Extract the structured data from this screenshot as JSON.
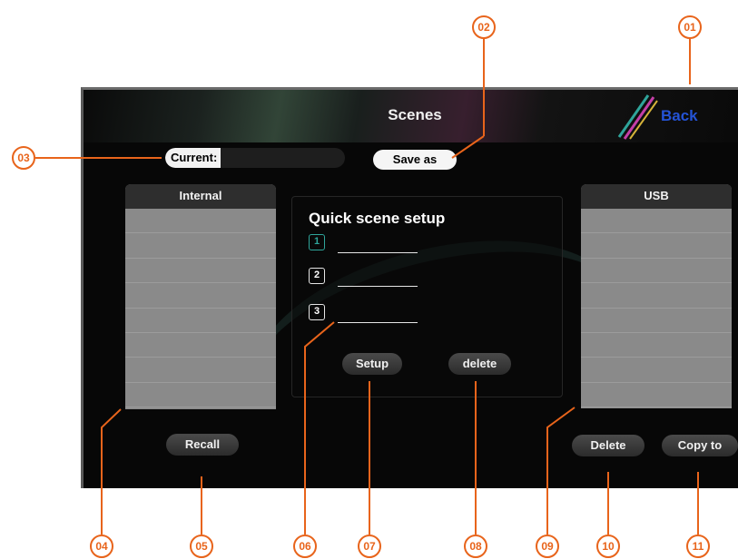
{
  "screen": {
    "title": "Scenes",
    "back_label": "Back",
    "current_label": "Current:",
    "current_value": "",
    "save_as_label": "Save as"
  },
  "internal": {
    "header": "Internal",
    "rows": [
      "",
      "",
      "",
      "",
      "",
      "",
      "",
      ""
    ],
    "recall_label": "Recall"
  },
  "usb": {
    "header": "USB",
    "rows": [
      "",
      "",
      "",
      "",
      "",
      "",
      "",
      ""
    ],
    "delete_label": "Delete",
    "copy_label": "Copy to"
  },
  "quick": {
    "title": "Quick scene setup",
    "slots": [
      {
        "number": "1",
        "name": ""
      },
      {
        "number": "2",
        "name": ""
      },
      {
        "number": "3",
        "name": ""
      }
    ],
    "setup_label": "Setup",
    "delete_label": "delete"
  },
  "callouts": {
    "c01": "01",
    "c02": "02",
    "c03": "03",
    "c04": "04",
    "c05": "05",
    "c06": "06",
    "c07": "07",
    "c08": "08",
    "c09": "09",
    "c10": "10",
    "c11": "11"
  },
  "colors": {
    "callout": "#e8641b",
    "back_label": "#2453d6",
    "active_slot": "#2fa59b"
  }
}
